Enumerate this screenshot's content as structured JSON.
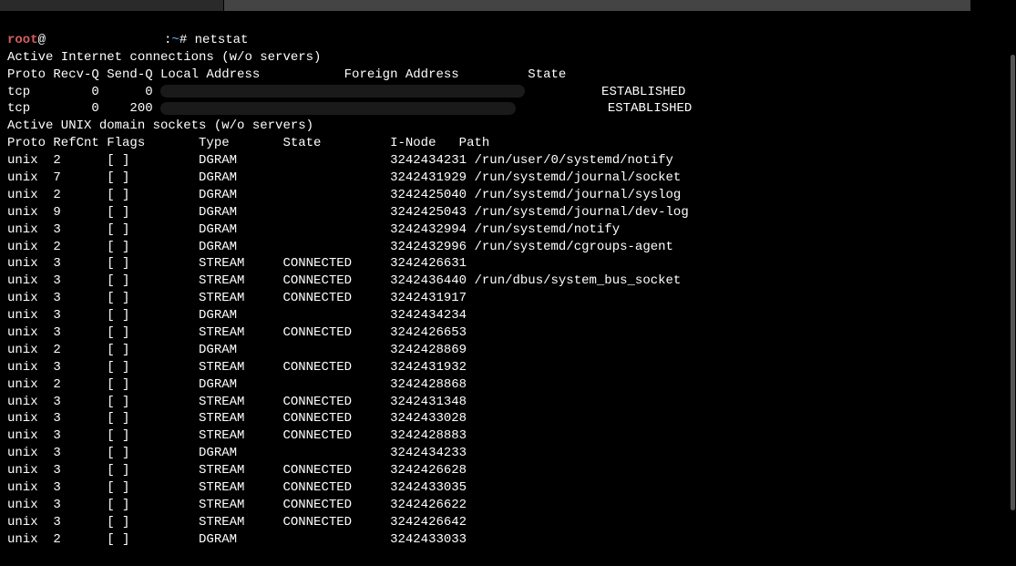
{
  "prompt": {
    "user": "root",
    "at": "@",
    "host_redacted": true,
    "path_sep": ":",
    "path": "~",
    "symbol": "# ",
    "command": "netstat"
  },
  "output": {
    "header_inet": "Active Internet connections (w/o servers)",
    "cols_inet": "Proto Recv-Q Send-Q Local Address           Foreign Address         State",
    "tcp_rows": [
      {
        "prefix": "tcp        0      0 ",
        "state_pad": "          ",
        "state": "ESTABLISHED"
      },
      {
        "prefix": "tcp        0    200 ",
        "state_pad": "            ",
        "state": "ESTABLISHED"
      }
    ],
    "header_unix": "Active UNIX domain sockets (w/o servers)",
    "cols_unix": "Proto RefCnt Flags       Type       State         I-Node   Path",
    "unix_rows": [
      "unix  2      [ ]         DGRAM                    3242434231 /run/user/0/systemd/notify",
      "unix  7      [ ]         DGRAM                    3242431929 /run/systemd/journal/socket",
      "unix  2      [ ]         DGRAM                    3242425040 /run/systemd/journal/syslog",
      "unix  9      [ ]         DGRAM                    3242425043 /run/systemd/journal/dev-log",
      "unix  3      [ ]         DGRAM                    3242432994 /run/systemd/notify",
      "unix  2      [ ]         DGRAM                    3242432996 /run/systemd/cgroups-agent",
      "unix  3      [ ]         STREAM     CONNECTED     3242426631 ",
      "unix  3      [ ]         STREAM     CONNECTED     3242436440 /run/dbus/system_bus_socket",
      "unix  3      [ ]         STREAM     CONNECTED     3242431917 ",
      "unix  3      [ ]         DGRAM                    3242434234 ",
      "unix  3      [ ]         STREAM     CONNECTED     3242426653 ",
      "unix  2      [ ]         DGRAM                    3242428869 ",
      "unix  3      [ ]         STREAM     CONNECTED     3242431932 ",
      "unix  2      [ ]         DGRAM                    3242428868 ",
      "unix  3      [ ]         STREAM     CONNECTED     3242431348 ",
      "unix  3      [ ]         STREAM     CONNECTED     3242433028 ",
      "unix  3      [ ]         STREAM     CONNECTED     3242428883 ",
      "unix  3      [ ]         DGRAM                    3242434233 ",
      "unix  3      [ ]         STREAM     CONNECTED     3242426628 ",
      "unix  3      [ ]         STREAM     CONNECTED     3242433035 ",
      "unix  3      [ ]         STREAM     CONNECTED     3242426622 ",
      "unix  3      [ ]         STREAM     CONNECTED     3242426642 ",
      "unix  2      [ ]         DGRAM                    3242433033 "
    ]
  }
}
